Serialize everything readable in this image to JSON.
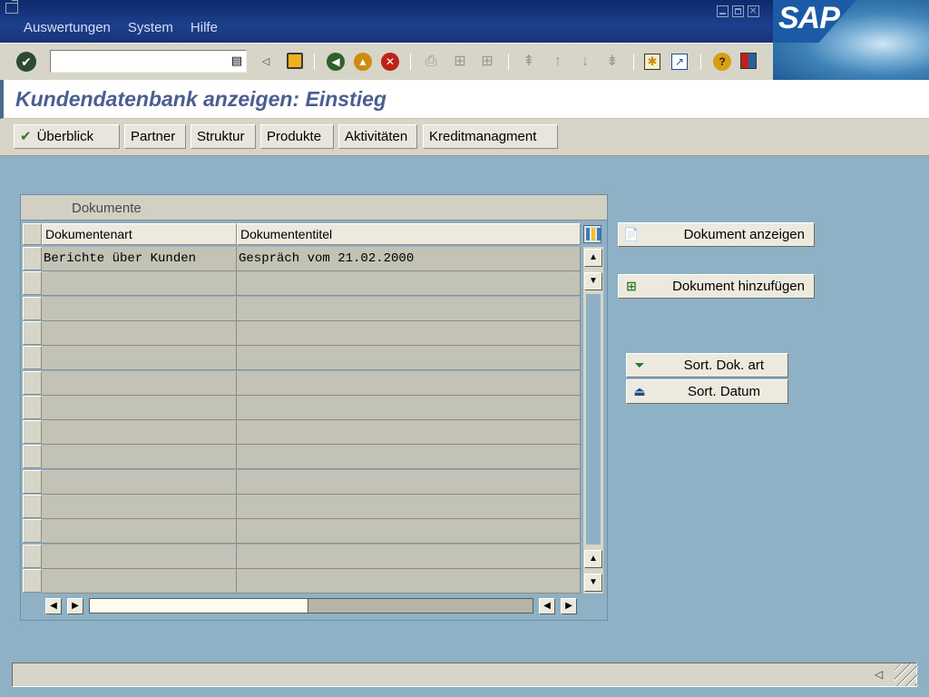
{
  "menubar": {
    "items": [
      {
        "label": "Auswertungen"
      },
      {
        "label": "System"
      },
      {
        "label": "Hilfe"
      }
    ]
  },
  "logo": {
    "text": "SAP"
  },
  "toolbar": {
    "command_field_value": "",
    "icons": [
      "enter-icon",
      "back-arrow-icon",
      "save-icon",
      "back-icon",
      "exit-icon",
      "cancel-icon",
      "print-icon",
      "find-icon",
      "find-next-icon",
      "first-page-icon",
      "previous-page-icon",
      "next-page-icon",
      "last-page-icon",
      "create-session-icon",
      "shortcut-icon",
      "help-icon",
      "layout-menu-icon"
    ]
  },
  "screen": {
    "title": "Kundendatenbank anzeigen: Einstieg"
  },
  "app_toolbar": {
    "buttons": [
      {
        "label": "Überblick"
      },
      {
        "label": "Partner"
      },
      {
        "label": "Struktur"
      },
      {
        "label": "Produkte"
      },
      {
        "label": "Aktivitäten"
      },
      {
        "label": "Kreditmanagment"
      }
    ]
  },
  "table": {
    "group_title": "Dokumente",
    "columns": [
      "Dokumentenart",
      "Dokumententitel"
    ],
    "rows": [
      [
        "Berichte über Kunden",
        "Gespräch vom 21.02.2000"
      ],
      [
        "",
        ""
      ],
      [
        "",
        ""
      ],
      [
        "",
        ""
      ],
      [
        "",
        ""
      ],
      [
        "",
        ""
      ],
      [
        "",
        ""
      ],
      [
        "",
        ""
      ],
      [
        "",
        ""
      ],
      [
        "",
        ""
      ],
      [
        "",
        ""
      ],
      [
        "",
        ""
      ],
      [
        "",
        ""
      ],
      [
        "",
        ""
      ]
    ]
  },
  "side_buttons": {
    "show_document": "Dokument anzeigen",
    "add_document": "Dokument hinzufügen",
    "sort_doc_type": "Sort. Dok. art",
    "sort_date": "Sort. Datum"
  },
  "statusbar": {
    "text": ""
  },
  "colors": {
    "background": "#8fb1c5",
    "title_bar": "#1d3f8c",
    "screen_title": "#4a5f8f",
    "toolbar": "#d7d4c8"
  }
}
